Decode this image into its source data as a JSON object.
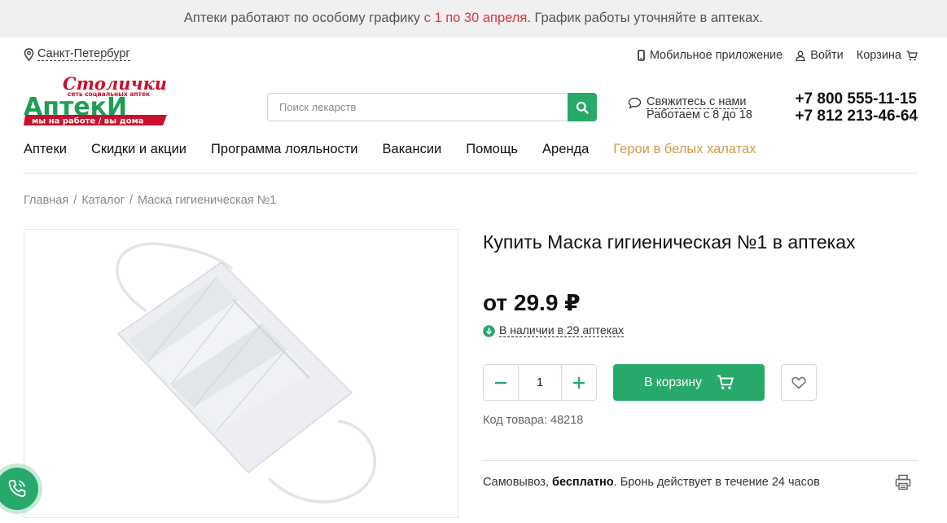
{
  "announcement": {
    "before": "Аптеки работают по особому графику ",
    "highlight": "с 1 по 30 апреля",
    "after": ". График работы уточняйте в аптеках."
  },
  "header": {
    "city": "Санкт-Петербург",
    "mobile_app": "Мобильное приложение",
    "login": "Войти",
    "cart": "Корзина",
    "logo": {
      "script": "Столички",
      "small": "сеть социальных аптек",
      "main": "АптекИ",
      "tagline": "мы на работе / вы дома"
    },
    "search_placeholder": "Поиск лекарств",
    "contact_link": "Свяжитесь с нами",
    "hours": "Работаем с 8 до 18",
    "phones": [
      "+7 800 555-11-15",
      "+7 812 213-46-64"
    ]
  },
  "nav": [
    "Аптеки",
    "Скидки и акции",
    "Программа лояльности",
    "Вакансии",
    "Помощь",
    "Аренда",
    "Герои в белых халатах"
  ],
  "breadcrumbs": [
    "Главная",
    "Каталог",
    "Маска гигиеническая №1"
  ],
  "product": {
    "title": "Купить Маска гигиеническая №1 в аптеках",
    "price": "от 29.9 ₽",
    "availability": "В наличии в 29 аптеках",
    "quantity": "1",
    "add_to_cart": "В корзину",
    "code_label": "Код товара:",
    "code": "48218",
    "pickup_prefix": "Самовывоз, ",
    "pickup_bold": "бесплатно",
    "pickup_suffix": ". Бронь действует в течение 24 часов"
  },
  "colors": {
    "accent": "#27a96b",
    "brand_red": "#c8102e",
    "brand_green": "#1f9d55",
    "highlight": "#e0363d",
    "hero_link": "#d39a4f"
  }
}
